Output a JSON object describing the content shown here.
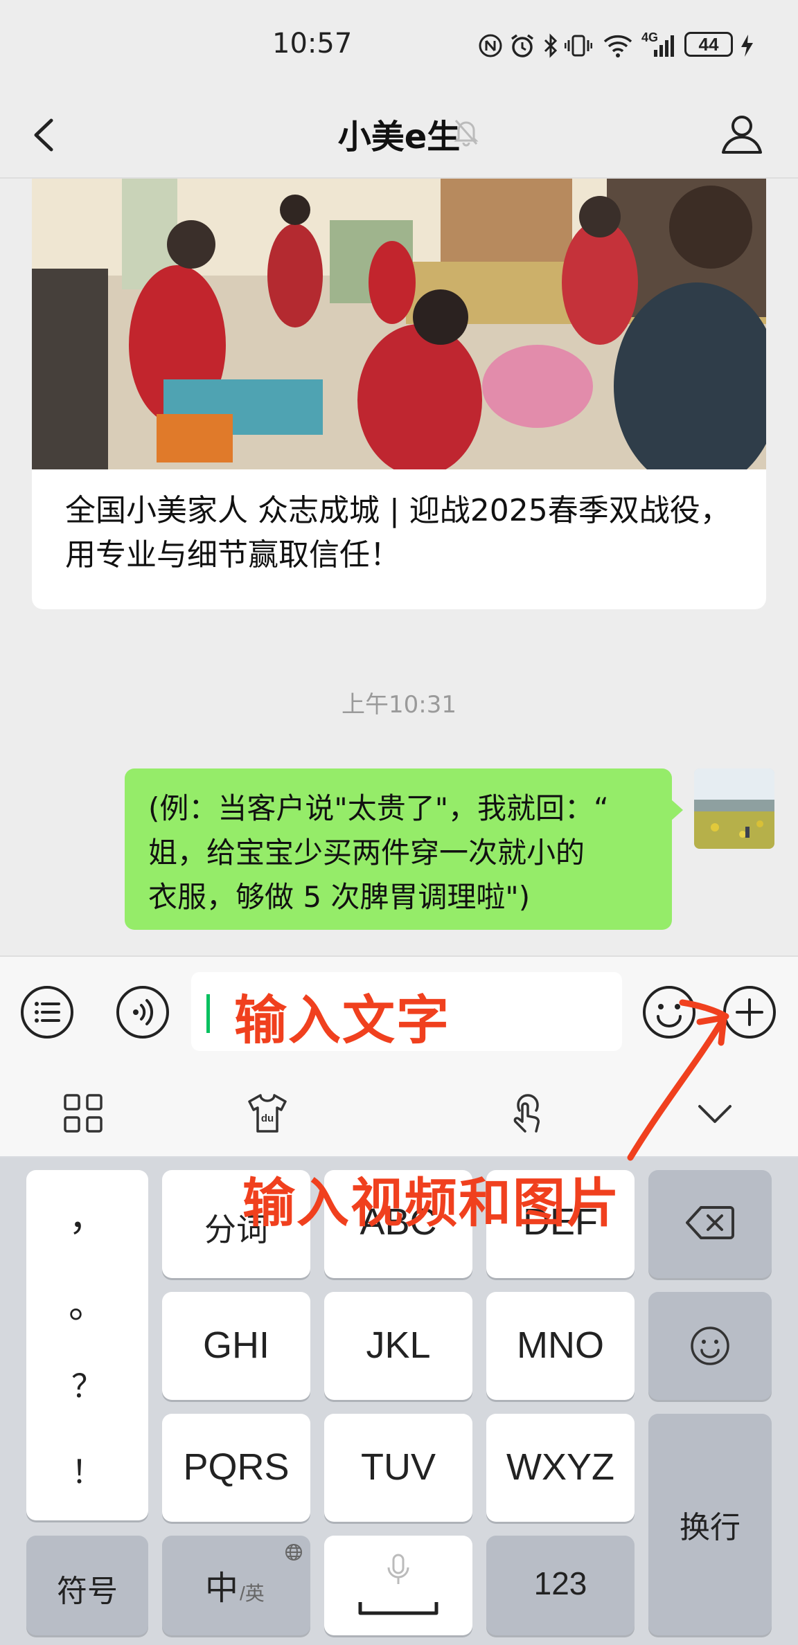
{
  "status_bar": {
    "time": "10:57",
    "network": "4G",
    "battery": "44",
    "icons": [
      "nfc-icon",
      "alarm-icon",
      "bluetooth-icon",
      "vibrate-icon",
      "wifi-icon",
      "signal-icon",
      "battery-icon",
      "charging-icon"
    ]
  },
  "nav": {
    "title": "小美e生",
    "back_icon": "chevron-left-icon",
    "mute_icon": "bell-off-icon",
    "profile_icon": "person-icon"
  },
  "article": {
    "title": "全国小美家人 众志成城 | 迎战2025春季双战役，用专业与细节赢取信任！"
  },
  "timestamp": "上午10:31",
  "message": {
    "line1": "(例：当客户说\"太贵了\"，我就回：“",
    "line2": "姐，给宝宝少买两件穿一次就小的",
    "line3": "衣服，够做 5 次脾胃调理啦\")"
  },
  "input_bar": {
    "annotation": "输入文字",
    "left_icons": [
      "list-icon",
      "voice-icon"
    ],
    "right_icons": [
      "emoji-icon",
      "plus-icon"
    ]
  },
  "keyboard_toolbar": {
    "icons": [
      "grid-icon",
      "tshirt-du-icon",
      "swipe-hand-icon",
      "chevron-down-icon"
    ],
    "tshirt_text": "du"
  },
  "keyboard": {
    "punct": [
      "，",
      "。",
      "？",
      "！"
    ],
    "keys": {
      "fenci": "分词",
      "abc": "ABC",
      "def": "DEF",
      "ghi": "GHI",
      "jkl": "JKL",
      "mno": "MNO",
      "pqrs": "PQRS",
      "tuv": "TUV",
      "wxyz": "WXYZ",
      "huanhang": "换行",
      "fuhao": "符号",
      "zhong": "中",
      "ying": "/英",
      "num": "123"
    }
  },
  "annotations": {
    "video": "输入视频和图片",
    "arrow_color": "#f0401e"
  },
  "colors": {
    "bubble": "#95ec69",
    "background": "#ededed",
    "accent": "#07c160",
    "annotation": "#f0401e"
  }
}
